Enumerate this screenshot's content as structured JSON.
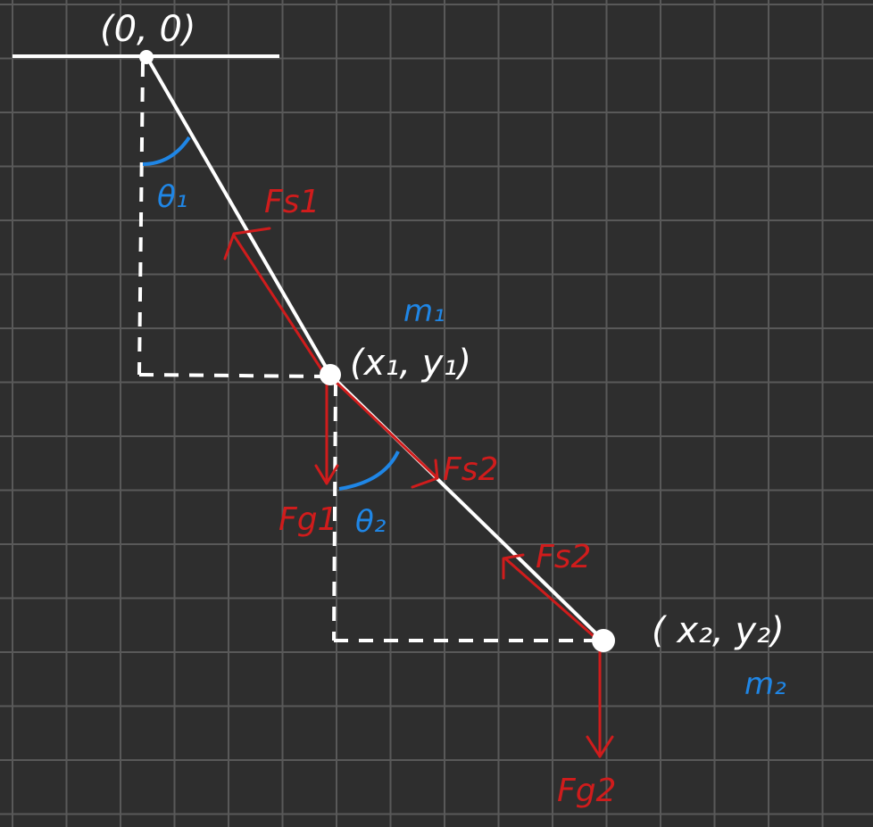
{
  "diagram": {
    "points": {
      "origin": "(0, 0)",
      "mass1": "(x₁, y₁)",
      "mass2": "( x₂, y₂)"
    },
    "masses": {
      "m1": "m₁",
      "m2": "m₂"
    },
    "angles": {
      "theta1": "θ₁",
      "theta2": "θ₂"
    },
    "forces": {
      "fs1": "Fs1",
      "fs2_upper": "Fs2",
      "fs2_lower": "Fs2",
      "fg1": "Fg1",
      "fg2": "Fg2"
    },
    "colors": {
      "background": "#2e2e2e",
      "grid": "#5a5a5a",
      "rod": "#ffffff",
      "force": "#d01c1c",
      "angle": "#1f86e6"
    }
  }
}
